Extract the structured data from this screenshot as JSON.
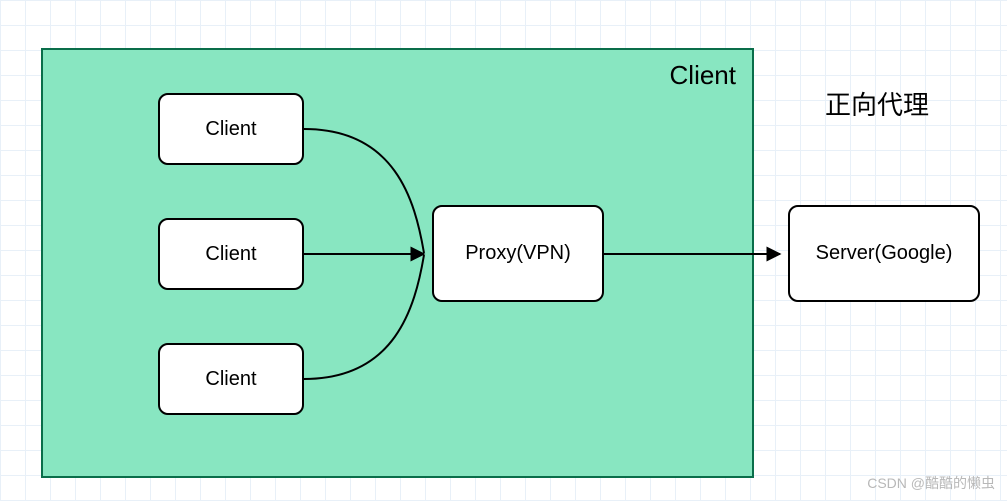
{
  "diagram": {
    "title": "正向代理",
    "container_label": "Client",
    "nodes": {
      "client1": "Client",
      "client2": "Client",
      "client3": "Client",
      "proxy": "Proxy(VPN)",
      "server": "Server(Google)"
    },
    "edges": [
      {
        "from": "client1",
        "to": "proxy"
      },
      {
        "from": "client2",
        "to": "proxy"
      },
      {
        "from": "client3",
        "to": "proxy"
      },
      {
        "from": "proxy",
        "to": "server"
      }
    ],
    "colors": {
      "container_fill": "#88e6c1",
      "container_border": "#0a6e4a",
      "node_fill": "#ffffff",
      "node_border": "#000000"
    }
  },
  "watermark": "CSDN @酷酷的懒虫"
}
